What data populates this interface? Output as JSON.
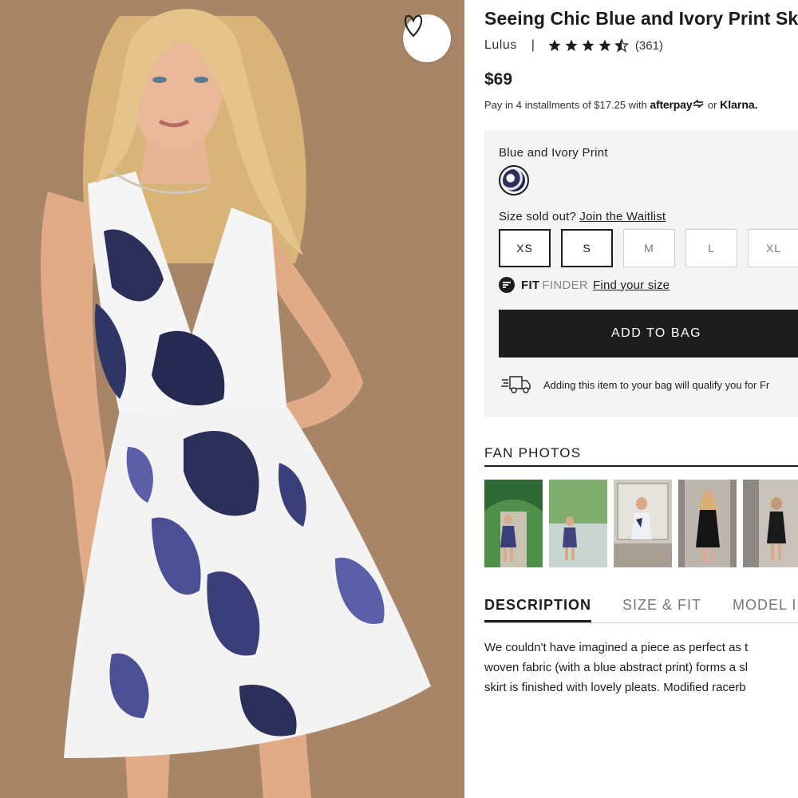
{
  "product": {
    "title": "Seeing Chic Blue and Ivory Print Sk",
    "brand": "Lulus",
    "separator": "|",
    "rating": 4.5,
    "review_count": "(361)",
    "price": "$69",
    "installments": {
      "prefix": "Pay in 4 installments of $17.25 with",
      "afterpay": "afterpay",
      "or": "or",
      "klarna": "Klarna."
    }
  },
  "options": {
    "color_name": "Blue and Ivory Print",
    "sold_out_text": "Size sold out?",
    "waitlist_link": "Join the Waitlist",
    "sizes": [
      {
        "label": "XS",
        "available": true
      },
      {
        "label": "S",
        "available": true
      },
      {
        "label": "M",
        "available": false
      },
      {
        "label": "L",
        "available": false
      },
      {
        "label": "XL",
        "available": false
      }
    ],
    "fit_strong": "FIT",
    "fit_light": "FINDER",
    "fit_link": "Find your size",
    "add_to_bag": "ADD TO BAG",
    "shipping_text": "Adding this item to your bag will qualify you for Fr"
  },
  "fan_photos": {
    "title": "FAN PHOTOS",
    "count": 5
  },
  "tabs": [
    "DESCRIPTION",
    "SIZE & FIT",
    "MODEL I"
  ],
  "description": [
    "We couldn't have imagined a piece as perfect as t",
    "woven fabric (with a blue abstract print) forms a sl",
    "skirt is finished with lovely pleats. Modified racerb"
  ],
  "icons": {
    "favorite": "heart-outline-icon",
    "star": "star-icon",
    "fit_finder": "fit-finder-logo-icon",
    "truck": "delivery-truck-icon"
  },
  "colors": {
    "background_photo": "#a88467",
    "button_dark": "#1d1d1d",
    "panel_bg": "#f4f4f4",
    "dress_print": "#2b2f5a"
  }
}
